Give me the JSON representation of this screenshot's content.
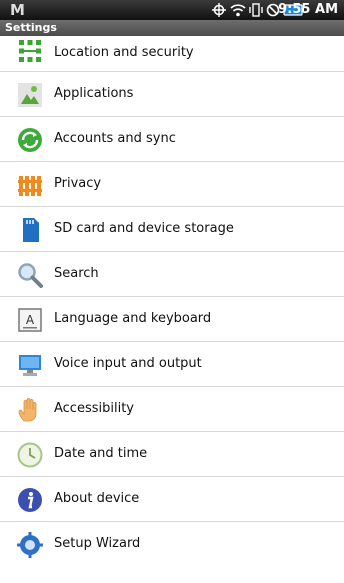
{
  "status_bar": {
    "app_letter": "M",
    "time": "9:55 AM",
    "icons": [
      "gps-icon",
      "wifi-icon",
      "vibrate-icon",
      "no-signal-icon",
      "battery-icon"
    ]
  },
  "title": "Settings",
  "items": [
    {
      "label": "Location and security",
      "icon": "location-security-icon"
    },
    {
      "label": "Applications",
      "icon": "applications-icon"
    },
    {
      "label": "Accounts and sync",
      "icon": "accounts-sync-icon"
    },
    {
      "label": "Privacy",
      "icon": "privacy-icon"
    },
    {
      "label": "SD card and device storage",
      "icon": "sd-card-icon"
    },
    {
      "label": "Search",
      "icon": "search-icon"
    },
    {
      "label": "Language and keyboard",
      "icon": "language-keyboard-icon"
    },
    {
      "label": "Voice input and output",
      "icon": "voice-io-icon"
    },
    {
      "label": "Accessibility",
      "icon": "accessibility-icon"
    },
    {
      "label": "Date and time",
      "icon": "clock-icon"
    },
    {
      "label": "About device",
      "icon": "info-icon"
    },
    {
      "label": "Setup Wizard",
      "icon": "wizard-icon"
    }
  ]
}
